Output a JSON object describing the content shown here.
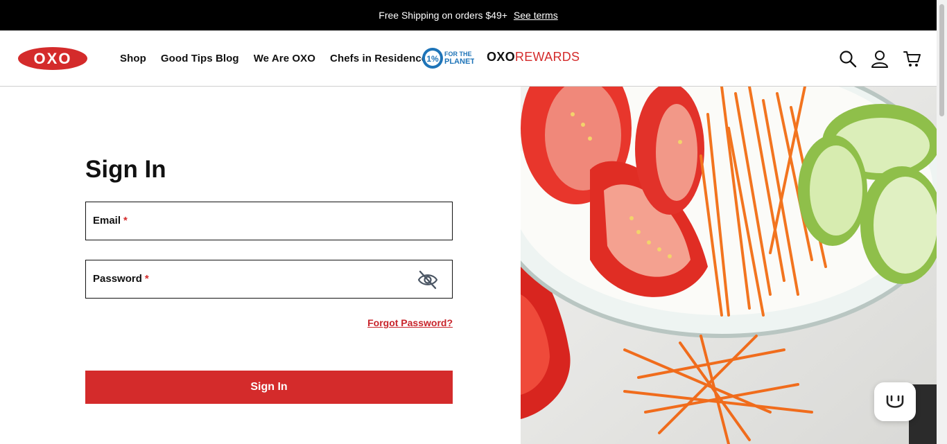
{
  "promo": {
    "text": "Free Shipping on orders $49+",
    "link": "See terms"
  },
  "brand": {
    "logo_text": "OXO",
    "primary_color": "#d42b2b"
  },
  "nav": {
    "items": [
      {
        "label": "Shop"
      },
      {
        "label": "Good Tips Blog"
      },
      {
        "label": "We Are OXO"
      },
      {
        "label": "Chefs in Residence"
      }
    ],
    "planet_badge": {
      "line1": "FOR THE",
      "line2": "PLANET",
      "mark": "1%"
    },
    "rewards": {
      "part1": "OXO",
      "part2": "REWARDS"
    },
    "icons": [
      "search-icon",
      "account-icon",
      "cart-icon"
    ]
  },
  "form": {
    "title": "Sign In",
    "email_label": "Email",
    "password_label": "Password",
    "required_mark": "*",
    "forgot_link": "Forgot Password?",
    "submit_label": "Sign In"
  },
  "hero": {
    "subject": "bowl of sliced tomatoes, cucumbers and julienned carrots"
  },
  "chat_widget": {
    "icon": "smiley-chat-icon"
  }
}
